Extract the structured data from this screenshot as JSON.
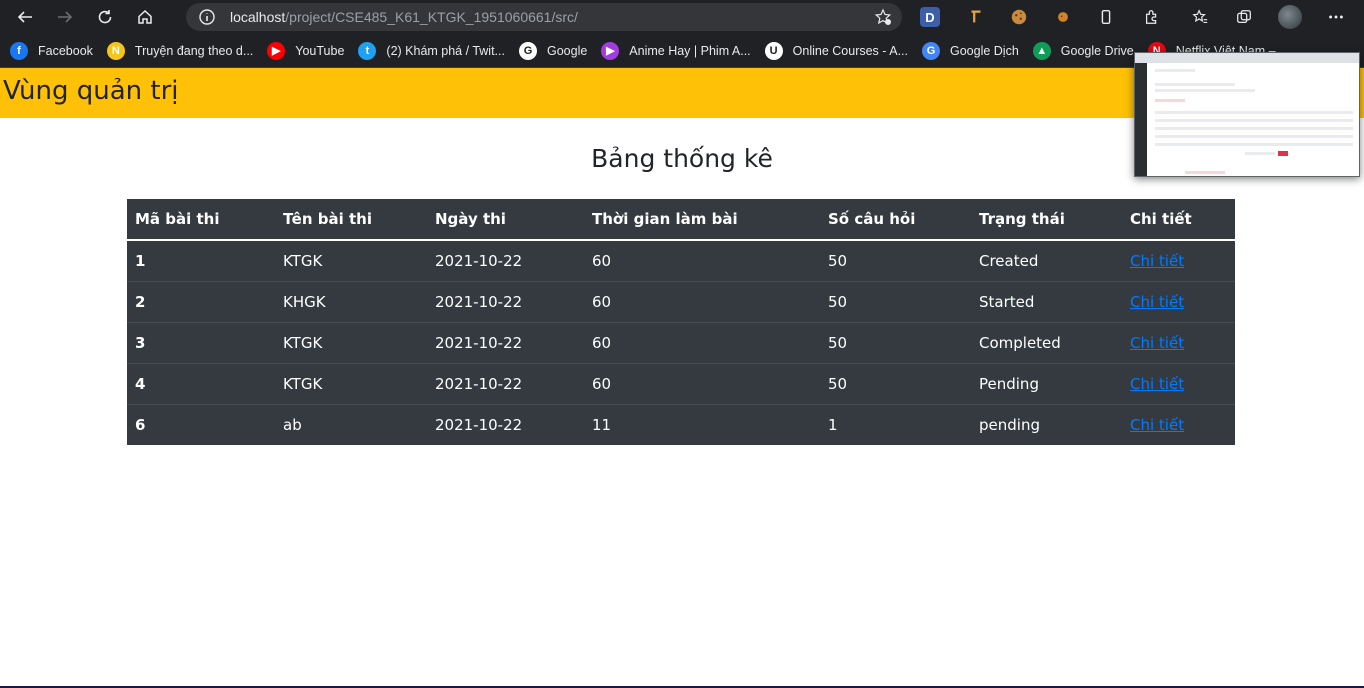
{
  "browser": {
    "url_host": "localhost",
    "url_path": "/project/CSE485_K61_KTGK_1951060661/src/",
    "extension_d_label": "D"
  },
  "bookmarks": [
    {
      "label": "Facebook",
      "icon": "facebook-icon",
      "color": "#1877f2",
      "glyph": "f"
    },
    {
      "label": "Truyện đang theo d...",
      "icon": "n-logo-icon",
      "color": "#f5c518",
      "glyph": "N"
    },
    {
      "label": "YouTube",
      "icon": "youtube-icon",
      "color": "#ff0000",
      "glyph": "▶"
    },
    {
      "label": "(2) Khám phá / Twit...",
      "icon": "twitter-icon",
      "color": "#1da1f2",
      "glyph": "t"
    },
    {
      "label": "Google",
      "icon": "google-icon",
      "color": "#ffffff",
      "glyph": "G"
    },
    {
      "label": "Anime Hay | Phim A...",
      "icon": "play-icon",
      "color": "#a33ce0",
      "glyph": "▶"
    },
    {
      "label": "Online Courses - A...",
      "icon": "udemy-icon",
      "color": "#ffffff",
      "glyph": "U"
    },
    {
      "label": "Google Dịch",
      "icon": "google-translate-icon",
      "color": "#4285f4",
      "glyph": "G"
    },
    {
      "label": "Google Drive",
      "icon": "google-drive-icon",
      "color": "#0f9d58",
      "glyph": "▲"
    },
    {
      "label": "Netflix Việt Nam –",
      "icon": "netflix-icon",
      "color": "#e50914",
      "glyph": "N"
    }
  ],
  "admin": {
    "title": "Vùng quản trị",
    "header_color": "#ffc107"
  },
  "page": {
    "title": "Bảng thống kê"
  },
  "table": {
    "headers": [
      "Mã bài thi",
      "Tên bài thi",
      "Ngày thi",
      "Thời gian làm bài",
      "Số câu hỏi",
      "Trạng thái",
      "Chi tiết"
    ],
    "rows": [
      {
        "id": "1",
        "name": "KTGK",
        "date": "2021-10-22",
        "duration": "60",
        "questions": "50",
        "status": "Created",
        "link": "Chi tiết"
      },
      {
        "id": "2",
        "name": "KHGK",
        "date": "2021-10-22",
        "duration": "60",
        "questions": "50",
        "status": "Started",
        "link": "Chi tiết"
      },
      {
        "id": "3",
        "name": "KTGK",
        "date": "2021-10-22",
        "duration": "60",
        "questions": "50",
        "status": "Completed",
        "link": "Chi tiết"
      },
      {
        "id": "4",
        "name": "KTGK",
        "date": "2021-10-22",
        "duration": "60",
        "questions": "50",
        "status": "Pending",
        "link": "Chi tiết"
      },
      {
        "id": "6",
        "name": "ab",
        "date": "2021-10-22",
        "duration": "11",
        "questions": "1",
        "status": "pending",
        "link": "Chi tiết"
      }
    ],
    "bg_color": "#343a40",
    "link_color": "#007bff"
  }
}
